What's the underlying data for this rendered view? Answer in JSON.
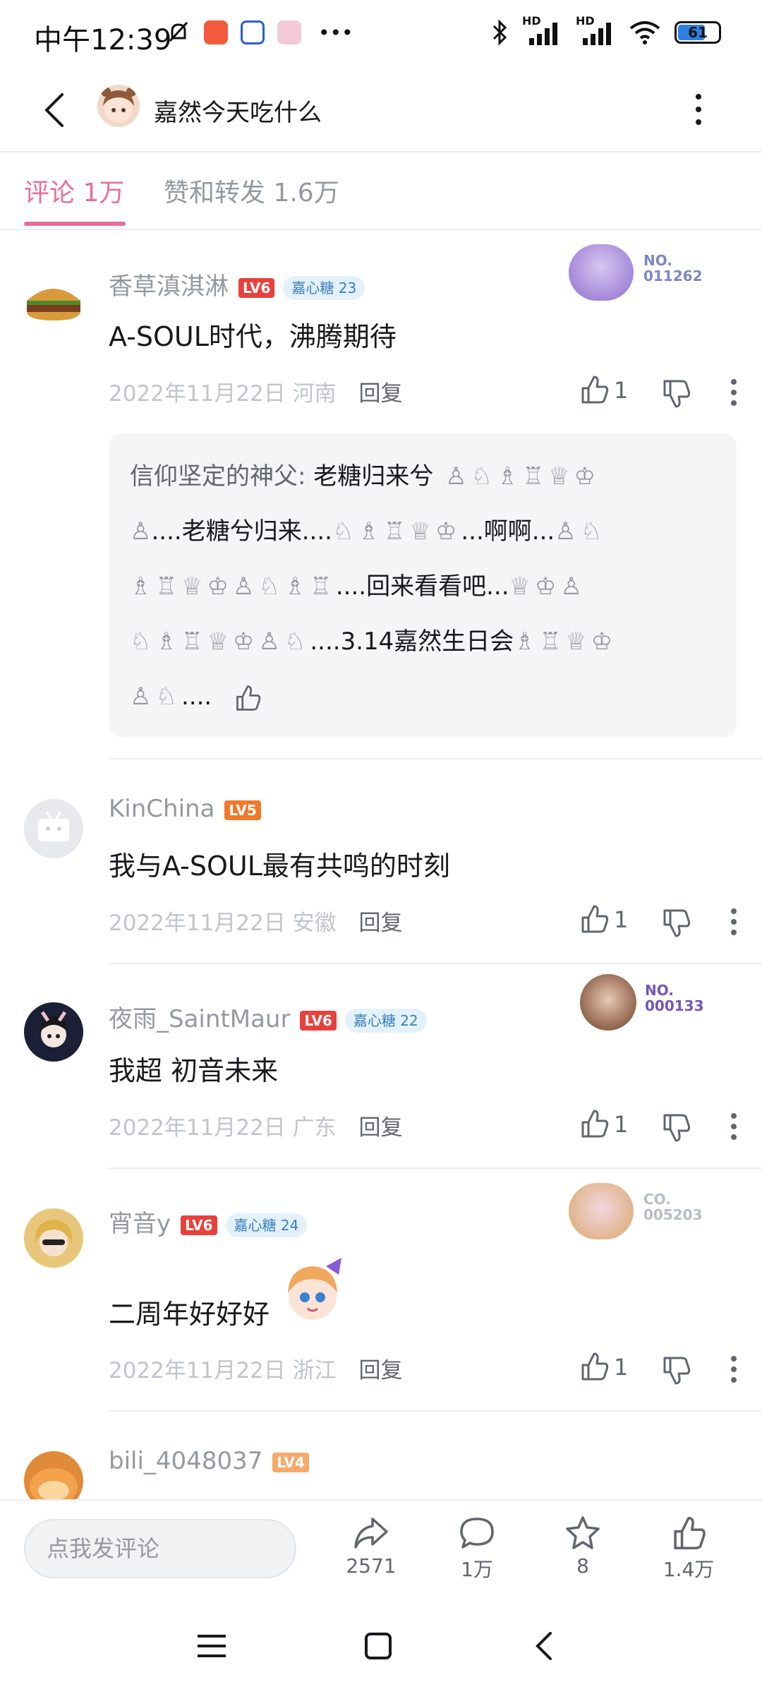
{
  "status_bar": {
    "time": "中午12:39",
    "dots": "•••",
    "hd1": "HD",
    "hd2": "HD",
    "battery": "61"
  },
  "header": {
    "title": "嘉然今天吃什么"
  },
  "tabs": [
    {
      "label": "评论 1万"
    },
    {
      "label": "赞和转发 1.6万"
    }
  ],
  "comments": [
    {
      "user": "香草滇淇淋",
      "level": "LV6",
      "fan_badge": "嘉心糖 23",
      "text": "A-SOUL时代，沸腾期待",
      "date": "2022年11月22日",
      "location": "河南",
      "reply": "回复",
      "likes": "1",
      "card_no": "NO.\n011262",
      "sub_reply": {
        "name": "信仰坚定的神父: ",
        "line1": "老糖归来兮",
        "line2": "....老糖兮归来....",
        "line2b": "...啊啊...",
        "line3": "....回来看看吧...",
        "line4": "....3.14嘉然生日会",
        "line5": "...."
      }
    },
    {
      "user": "KinChina",
      "level": "LV5",
      "text": "我与A-SOUL最有共鸣的时刻",
      "date": "2022年11月22日",
      "location": "安徽",
      "reply": "回复",
      "likes": "1"
    },
    {
      "user": "夜雨_SaintMaur",
      "level": "LV6",
      "fan_badge": "嘉心糖 22",
      "text": "我超 初音未来",
      "date": "2022年11月22日",
      "location": "广东",
      "reply": "回复",
      "likes": "1",
      "card_no": "NO.\n000133"
    },
    {
      "user": "宵音y",
      "level": "LV6",
      "fan_badge": "嘉心糖 24",
      "text": "二周年好好好",
      "date": "2022年11月22日",
      "location": "浙江",
      "reply": "回复",
      "likes": "1",
      "card_no": "CO.\n005203"
    },
    {
      "user": "bili_4048037",
      "level": "LV4"
    }
  ],
  "bottom_bar": {
    "input_placeholder": "点我发评论",
    "share_count": "2571",
    "comment_count": "1万",
    "fav_count": "8",
    "like_count": "1.4万"
  },
  "colors": {
    "accent": "#e86f98",
    "lv6": "#e8413c",
    "lv5": "#f07a2a",
    "lv4": "#f6a96b"
  }
}
